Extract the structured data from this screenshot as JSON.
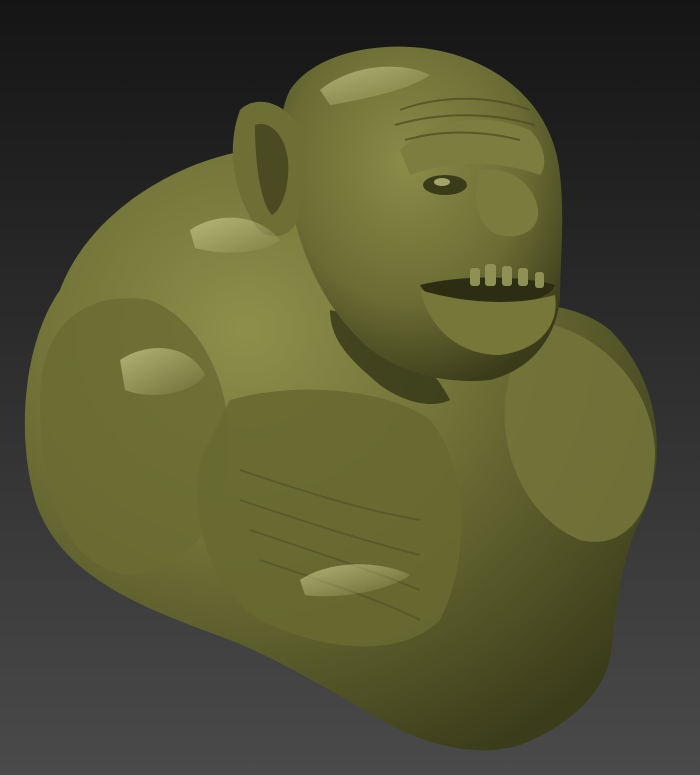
{
  "viewport": {
    "background_top": "#151515",
    "background_bottom": "#4a4a4a"
  },
  "sculpt": {
    "subject": "orc-bust",
    "material_color": "#6f7137",
    "highlight_color": "#b9b97a",
    "shadow_color": "#2a2b12",
    "icon": "sculpt-bust-icon"
  }
}
